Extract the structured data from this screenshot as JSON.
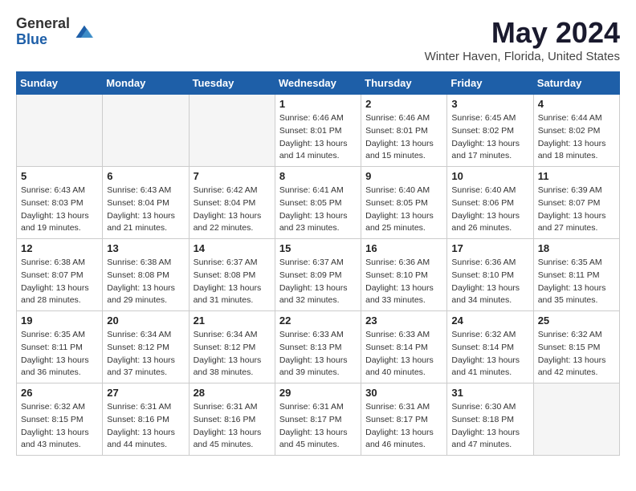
{
  "header": {
    "logo_general": "General",
    "logo_blue": "Blue",
    "month_year": "May 2024",
    "location": "Winter Haven, Florida, United States"
  },
  "weekdays": [
    "Sunday",
    "Monday",
    "Tuesday",
    "Wednesday",
    "Thursday",
    "Friday",
    "Saturday"
  ],
  "weeks": [
    [
      {
        "day": "",
        "sunrise": "",
        "sunset": "",
        "daylight": "",
        "empty": true
      },
      {
        "day": "",
        "sunrise": "",
        "sunset": "",
        "daylight": "",
        "empty": true
      },
      {
        "day": "",
        "sunrise": "",
        "sunset": "",
        "daylight": "",
        "empty": true
      },
      {
        "day": "1",
        "sunrise": "Sunrise: 6:46 AM",
        "sunset": "Sunset: 8:01 PM",
        "daylight": "Daylight: 13 hours and 14 minutes.",
        "empty": false
      },
      {
        "day": "2",
        "sunrise": "Sunrise: 6:46 AM",
        "sunset": "Sunset: 8:01 PM",
        "daylight": "Daylight: 13 hours and 15 minutes.",
        "empty": false
      },
      {
        "day": "3",
        "sunrise": "Sunrise: 6:45 AM",
        "sunset": "Sunset: 8:02 PM",
        "daylight": "Daylight: 13 hours and 17 minutes.",
        "empty": false
      },
      {
        "day": "4",
        "sunrise": "Sunrise: 6:44 AM",
        "sunset": "Sunset: 8:02 PM",
        "daylight": "Daylight: 13 hours and 18 minutes.",
        "empty": false
      }
    ],
    [
      {
        "day": "5",
        "sunrise": "Sunrise: 6:43 AM",
        "sunset": "Sunset: 8:03 PM",
        "daylight": "Daylight: 13 hours and 19 minutes.",
        "empty": false
      },
      {
        "day": "6",
        "sunrise": "Sunrise: 6:43 AM",
        "sunset": "Sunset: 8:04 PM",
        "daylight": "Daylight: 13 hours and 21 minutes.",
        "empty": false
      },
      {
        "day": "7",
        "sunrise": "Sunrise: 6:42 AM",
        "sunset": "Sunset: 8:04 PM",
        "daylight": "Daylight: 13 hours and 22 minutes.",
        "empty": false
      },
      {
        "day": "8",
        "sunrise": "Sunrise: 6:41 AM",
        "sunset": "Sunset: 8:05 PM",
        "daylight": "Daylight: 13 hours and 23 minutes.",
        "empty": false
      },
      {
        "day": "9",
        "sunrise": "Sunrise: 6:40 AM",
        "sunset": "Sunset: 8:05 PM",
        "daylight": "Daylight: 13 hours and 25 minutes.",
        "empty": false
      },
      {
        "day": "10",
        "sunrise": "Sunrise: 6:40 AM",
        "sunset": "Sunset: 8:06 PM",
        "daylight": "Daylight: 13 hours and 26 minutes.",
        "empty": false
      },
      {
        "day": "11",
        "sunrise": "Sunrise: 6:39 AM",
        "sunset": "Sunset: 8:07 PM",
        "daylight": "Daylight: 13 hours and 27 minutes.",
        "empty": false
      }
    ],
    [
      {
        "day": "12",
        "sunrise": "Sunrise: 6:38 AM",
        "sunset": "Sunset: 8:07 PM",
        "daylight": "Daylight: 13 hours and 28 minutes.",
        "empty": false
      },
      {
        "day": "13",
        "sunrise": "Sunrise: 6:38 AM",
        "sunset": "Sunset: 8:08 PM",
        "daylight": "Daylight: 13 hours and 29 minutes.",
        "empty": false
      },
      {
        "day": "14",
        "sunrise": "Sunrise: 6:37 AM",
        "sunset": "Sunset: 8:08 PM",
        "daylight": "Daylight: 13 hours and 31 minutes.",
        "empty": false
      },
      {
        "day": "15",
        "sunrise": "Sunrise: 6:37 AM",
        "sunset": "Sunset: 8:09 PM",
        "daylight": "Daylight: 13 hours and 32 minutes.",
        "empty": false
      },
      {
        "day": "16",
        "sunrise": "Sunrise: 6:36 AM",
        "sunset": "Sunset: 8:10 PM",
        "daylight": "Daylight: 13 hours and 33 minutes.",
        "empty": false
      },
      {
        "day": "17",
        "sunrise": "Sunrise: 6:36 AM",
        "sunset": "Sunset: 8:10 PM",
        "daylight": "Daylight: 13 hours and 34 minutes.",
        "empty": false
      },
      {
        "day": "18",
        "sunrise": "Sunrise: 6:35 AM",
        "sunset": "Sunset: 8:11 PM",
        "daylight": "Daylight: 13 hours and 35 minutes.",
        "empty": false
      }
    ],
    [
      {
        "day": "19",
        "sunrise": "Sunrise: 6:35 AM",
        "sunset": "Sunset: 8:11 PM",
        "daylight": "Daylight: 13 hours and 36 minutes.",
        "empty": false
      },
      {
        "day": "20",
        "sunrise": "Sunrise: 6:34 AM",
        "sunset": "Sunset: 8:12 PM",
        "daylight": "Daylight: 13 hours and 37 minutes.",
        "empty": false
      },
      {
        "day": "21",
        "sunrise": "Sunrise: 6:34 AM",
        "sunset": "Sunset: 8:12 PM",
        "daylight": "Daylight: 13 hours and 38 minutes.",
        "empty": false
      },
      {
        "day": "22",
        "sunrise": "Sunrise: 6:33 AM",
        "sunset": "Sunset: 8:13 PM",
        "daylight": "Daylight: 13 hours and 39 minutes.",
        "empty": false
      },
      {
        "day": "23",
        "sunrise": "Sunrise: 6:33 AM",
        "sunset": "Sunset: 8:14 PM",
        "daylight": "Daylight: 13 hours and 40 minutes.",
        "empty": false
      },
      {
        "day": "24",
        "sunrise": "Sunrise: 6:32 AM",
        "sunset": "Sunset: 8:14 PM",
        "daylight": "Daylight: 13 hours and 41 minutes.",
        "empty": false
      },
      {
        "day": "25",
        "sunrise": "Sunrise: 6:32 AM",
        "sunset": "Sunset: 8:15 PM",
        "daylight": "Daylight: 13 hours and 42 minutes.",
        "empty": false
      }
    ],
    [
      {
        "day": "26",
        "sunrise": "Sunrise: 6:32 AM",
        "sunset": "Sunset: 8:15 PM",
        "daylight": "Daylight: 13 hours and 43 minutes.",
        "empty": false
      },
      {
        "day": "27",
        "sunrise": "Sunrise: 6:31 AM",
        "sunset": "Sunset: 8:16 PM",
        "daylight": "Daylight: 13 hours and 44 minutes.",
        "empty": false
      },
      {
        "day": "28",
        "sunrise": "Sunrise: 6:31 AM",
        "sunset": "Sunset: 8:16 PM",
        "daylight": "Daylight: 13 hours and 45 minutes.",
        "empty": false
      },
      {
        "day": "29",
        "sunrise": "Sunrise: 6:31 AM",
        "sunset": "Sunset: 8:17 PM",
        "daylight": "Daylight: 13 hours and 45 minutes.",
        "empty": false
      },
      {
        "day": "30",
        "sunrise": "Sunrise: 6:31 AM",
        "sunset": "Sunset: 8:17 PM",
        "daylight": "Daylight: 13 hours and 46 minutes.",
        "empty": false
      },
      {
        "day": "31",
        "sunrise": "Sunrise: 6:30 AM",
        "sunset": "Sunset: 8:18 PM",
        "daylight": "Daylight: 13 hours and 47 minutes.",
        "empty": false
      },
      {
        "day": "",
        "sunrise": "",
        "sunset": "",
        "daylight": "",
        "empty": true
      }
    ]
  ]
}
